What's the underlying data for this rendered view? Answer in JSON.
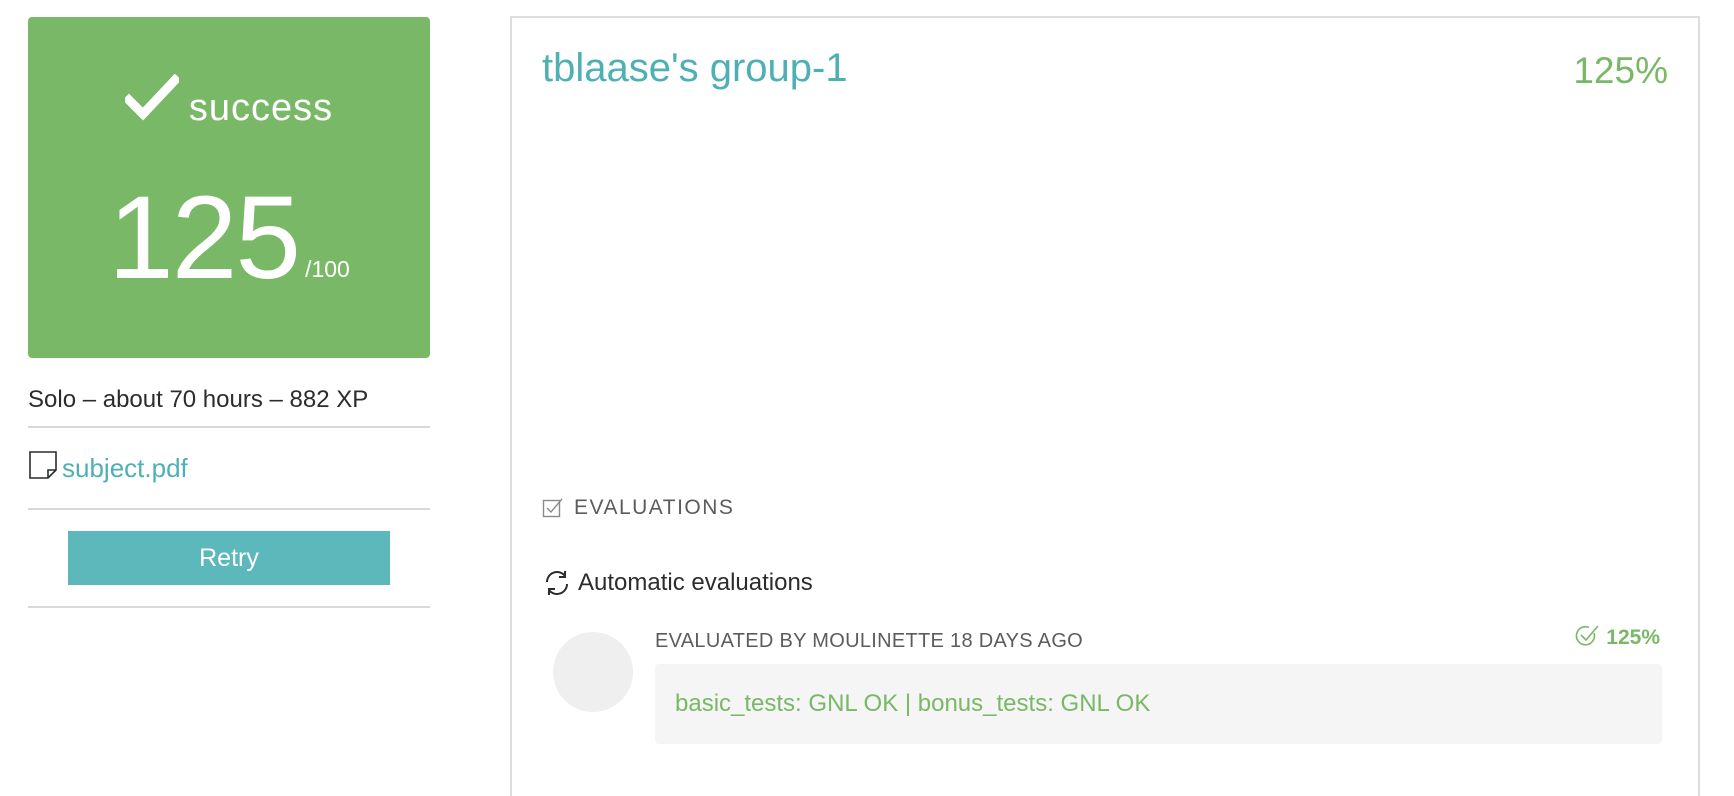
{
  "score_card": {
    "status": "success",
    "score": "125",
    "max": "/100",
    "check_icon": "checkmark-icon",
    "color": "#79b866"
  },
  "project_meta": {
    "line": "Solo – about 70 hours – 882 XP"
  },
  "attachment": {
    "icon": "document-icon",
    "label": "subject.pdf"
  },
  "actions": {
    "retry_label": "Retry"
  },
  "team": {
    "name": "tblaase's group-1",
    "percent": "125%"
  },
  "evaluations": {
    "section_title": "EVALUATIONS",
    "section_icon": "checkbox-icon",
    "automatic_label": "Automatic evaluations",
    "automatic_icon": "refresh-icon",
    "items": [
      {
        "evaluator": "EVALUATED BY MOULINETTE 18 DAYS AGO",
        "score": "125%",
        "result": "basic_tests: GNL OK | bonus_tests: GNL OK"
      }
    ]
  },
  "colors": {
    "accent": "#4fb0b4",
    "success": "#79b866",
    "button": "#5cb8bb"
  }
}
